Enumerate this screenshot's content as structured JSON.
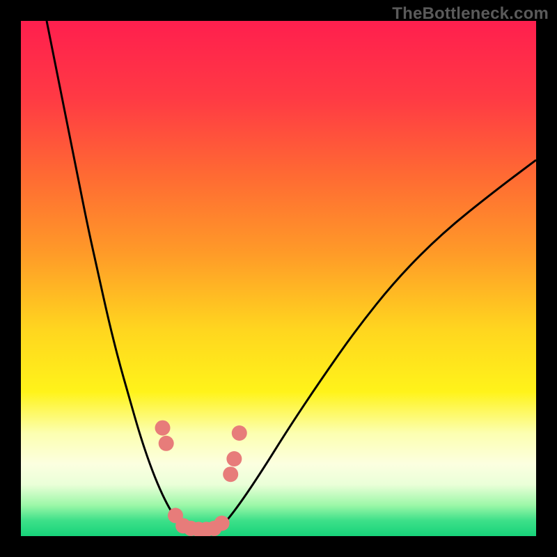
{
  "attribution": "TheBottleneck.com",
  "chart_data": {
    "type": "line",
    "title": "",
    "xlabel": "",
    "ylabel": "",
    "xlim": [
      0,
      100
    ],
    "ylim": [
      0,
      100
    ],
    "annotations": [],
    "gradient_stops": [
      {
        "offset": 0.0,
        "color": "#ff1f4e"
      },
      {
        "offset": 0.15,
        "color": "#ff3a44"
      },
      {
        "offset": 0.3,
        "color": "#ff6a33"
      },
      {
        "offset": 0.45,
        "color": "#ff9a28"
      },
      {
        "offset": 0.6,
        "color": "#ffd61f"
      },
      {
        "offset": 0.72,
        "color": "#fff31a"
      },
      {
        "offset": 0.8,
        "color": "#fcffb0"
      },
      {
        "offset": 0.86,
        "color": "#fcffe0"
      },
      {
        "offset": 0.9,
        "color": "#eaffd8"
      },
      {
        "offset": 0.94,
        "color": "#9cf7a8"
      },
      {
        "offset": 0.97,
        "color": "#3de089"
      },
      {
        "offset": 1.0,
        "color": "#17d37a"
      }
    ],
    "series": [
      {
        "name": "left-curve",
        "color": "#000000",
        "x": [
          5,
          7,
          9,
          11,
          13,
          15,
          17,
          19,
          21,
          23,
          25,
          27,
          29,
          30.5,
          32
        ],
        "y": [
          100,
          90,
          80,
          70,
          60,
          51,
          42,
          34,
          27,
          20,
          14,
          9,
          5,
          3,
          1
        ]
      },
      {
        "name": "right-curve",
        "color": "#000000",
        "x": [
          38,
          40,
          43,
          47,
          52,
          58,
          65,
          73,
          82,
          92,
          100
        ],
        "y": [
          1,
          3,
          7,
          13,
          21,
          30,
          40,
          50,
          59,
          67,
          73
        ]
      },
      {
        "name": "floor",
        "color": "#000000",
        "x": [
          32,
          38
        ],
        "y": [
          1,
          1
        ]
      }
    ],
    "markers": {
      "name": "salmon-dots",
      "color": "#e77c7a",
      "radius_px": 11,
      "points": [
        {
          "x": 27.5,
          "y": 21
        },
        {
          "x": 28.2,
          "y": 18
        },
        {
          "x": 30.0,
          "y": 4
        },
        {
          "x": 31.5,
          "y": 2
        },
        {
          "x": 33.0,
          "y": 1.5
        },
        {
          "x": 34.5,
          "y": 1.3
        },
        {
          "x": 36.0,
          "y": 1.3
        },
        {
          "x": 37.5,
          "y": 1.5
        },
        {
          "x": 39.0,
          "y": 2.5
        },
        {
          "x": 40.7,
          "y": 12
        },
        {
          "x": 41.4,
          "y": 15
        },
        {
          "x": 42.4,
          "y": 20
        }
      ]
    }
  }
}
